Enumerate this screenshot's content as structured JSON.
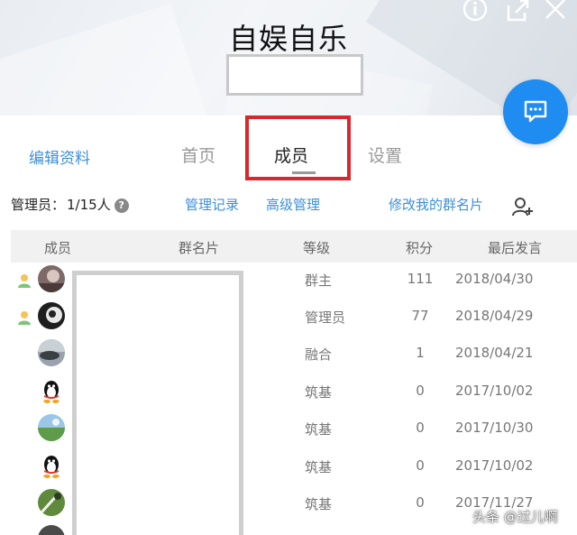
{
  "header": {
    "title": "自娱自乐",
    "icons": [
      "info-icon",
      "share-icon",
      "close-icon"
    ]
  },
  "chat_button": {
    "icon": "chat-bubble-icon"
  },
  "tabs": [
    {
      "label": "编辑资料",
      "style": "link"
    },
    {
      "label": "首页"
    },
    {
      "label": "成员",
      "active": true
    },
    {
      "label": "设置"
    }
  ],
  "toolbar": {
    "admin_label": "管理员：",
    "admin_count": "1/15人",
    "help": "?",
    "manage_log": "管理记录",
    "advanced_manage": "高级管理",
    "edit_card": "修改我的群名片"
  },
  "table": {
    "columns": [
      "成员",
      "群名片",
      "等级",
      "积分",
      "最后发言"
    ],
    "rows": [
      {
        "role_icon": "owner",
        "avatar": "photo",
        "level": "群主",
        "points": "111",
        "last": "2018/04/30"
      },
      {
        "role_icon": "admin",
        "avatar": "photo",
        "level": "管理员",
        "points": "77",
        "last": "2018/04/29"
      },
      {
        "role_icon": "",
        "avatar": "photo",
        "level": "融合",
        "points": "1",
        "last": "2018/04/21"
      },
      {
        "role_icon": "",
        "avatar": "penguin",
        "level": "筑基",
        "points": "0",
        "last": "2017/10/02"
      },
      {
        "role_icon": "",
        "avatar": "landscape",
        "level": "筑基",
        "points": "0",
        "last": "2017/10/30"
      },
      {
        "role_icon": "",
        "avatar": "penguin",
        "level": "筑基",
        "points": "0",
        "last": "2017/10/02"
      },
      {
        "role_icon": "",
        "avatar": "nature",
        "level": "筑基",
        "points": "0",
        "last": "2017/11/27"
      }
    ]
  },
  "colors": {
    "accent": "#1e8cf0",
    "link": "#3d8fd8",
    "highlight": "#d9272e"
  },
  "watermark": "头条 @过儿啊"
}
